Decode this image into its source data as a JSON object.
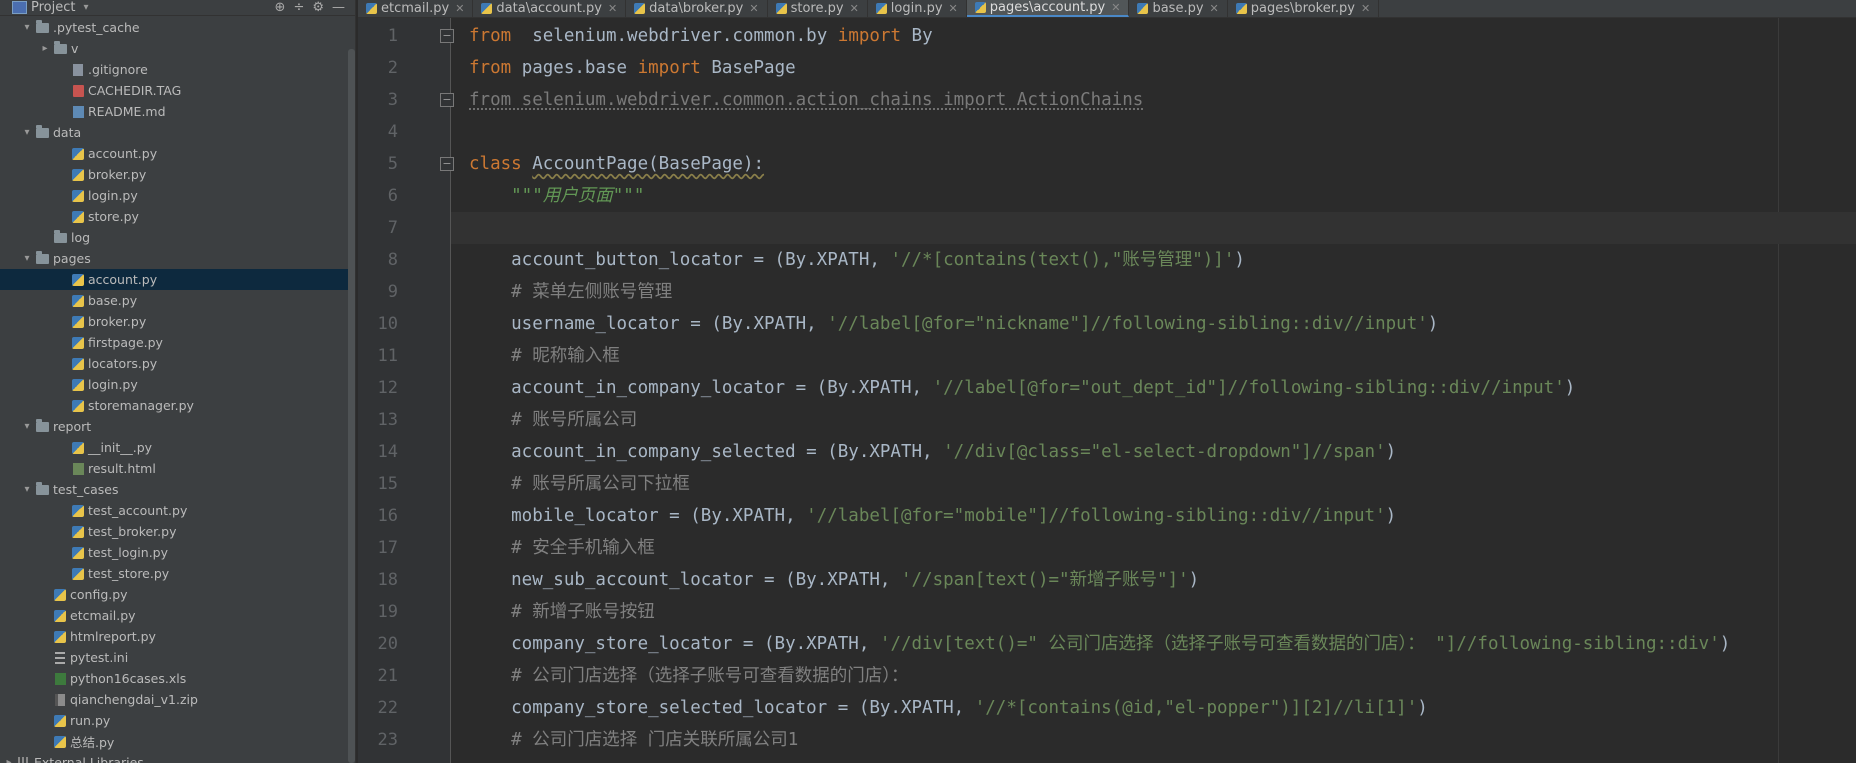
{
  "project_panel": {
    "title": "Project",
    "tools": [
      "⊕",
      "÷",
      "⚙",
      "—"
    ]
  },
  "tree": [
    {
      "depth": 1,
      "arrow": "▾",
      "icon": "folder",
      "label": ".pytest_cache"
    },
    {
      "depth": 2,
      "arrow": "▸",
      "icon": "folder",
      "label": "v"
    },
    {
      "depth": 3,
      "arrow": "",
      "icon": "file",
      "label": ".gitignore"
    },
    {
      "depth": 3,
      "arrow": "",
      "icon": "tag",
      "label": "CACHEDIR.TAG"
    },
    {
      "depth": 3,
      "arrow": "",
      "icon": "md",
      "label": "README.md"
    },
    {
      "depth": 1,
      "arrow": "▾",
      "icon": "folder",
      "label": "data"
    },
    {
      "depth": 3,
      "arrow": "",
      "icon": "py",
      "label": "account.py"
    },
    {
      "depth": 3,
      "arrow": "",
      "icon": "py",
      "label": "broker.py"
    },
    {
      "depth": 3,
      "arrow": "",
      "icon": "py",
      "label": "login.py"
    },
    {
      "depth": 3,
      "arrow": "",
      "icon": "py",
      "label": "store.py"
    },
    {
      "depth": 2,
      "arrow": "",
      "icon": "folder",
      "label": "log"
    },
    {
      "depth": 1,
      "arrow": "▾",
      "icon": "folder",
      "label": "pages"
    },
    {
      "depth": 3,
      "arrow": "",
      "icon": "py",
      "label": "account.py",
      "selected": true
    },
    {
      "depth": 3,
      "arrow": "",
      "icon": "py",
      "label": "base.py"
    },
    {
      "depth": 3,
      "arrow": "",
      "icon": "py",
      "label": "broker.py"
    },
    {
      "depth": 3,
      "arrow": "",
      "icon": "py",
      "label": "firstpage.py"
    },
    {
      "depth": 3,
      "arrow": "",
      "icon": "py",
      "label": "locators.py"
    },
    {
      "depth": 3,
      "arrow": "",
      "icon": "py",
      "label": "login.py"
    },
    {
      "depth": 3,
      "arrow": "",
      "icon": "py",
      "label": "storemanager.py"
    },
    {
      "depth": 1,
      "arrow": "▾",
      "icon": "folder",
      "label": "report"
    },
    {
      "depth": 3,
      "arrow": "",
      "icon": "py",
      "label": "__init__.py"
    },
    {
      "depth": 3,
      "arrow": "",
      "icon": "html",
      "label": "result.html"
    },
    {
      "depth": 1,
      "arrow": "▾",
      "icon": "folder",
      "label": "test_cases"
    },
    {
      "depth": 3,
      "arrow": "",
      "icon": "py",
      "label": "test_account.py"
    },
    {
      "depth": 3,
      "arrow": "",
      "icon": "py",
      "label": "test_broker.py"
    },
    {
      "depth": 3,
      "arrow": "",
      "icon": "py",
      "label": "test_login.py"
    },
    {
      "depth": 3,
      "arrow": "",
      "icon": "py",
      "label": "test_store.py"
    },
    {
      "depth": 2,
      "arrow": "",
      "icon": "py",
      "label": "config.py"
    },
    {
      "depth": 2,
      "arrow": "",
      "icon": "py",
      "label": "etcmail.py"
    },
    {
      "depth": 2,
      "arrow": "",
      "icon": "py",
      "label": "htmlreport.py"
    },
    {
      "depth": 2,
      "arrow": "",
      "icon": "ini",
      "label": "pytest.ini"
    },
    {
      "depth": 2,
      "arrow": "",
      "icon": "xls",
      "label": "python16cases.xls"
    },
    {
      "depth": 2,
      "arrow": "",
      "icon": "zip",
      "label": "qianchengdai_v1.zip"
    },
    {
      "depth": 2,
      "arrow": "",
      "icon": "py",
      "label": "run.py"
    },
    {
      "depth": 2,
      "arrow": "",
      "icon": "py",
      "label": "总结.py"
    },
    {
      "depth": 0,
      "arrow": "▸",
      "icon": "lib",
      "label": "External Libraries"
    }
  ],
  "tabs": [
    {
      "label": "etcmail.py",
      "active": false
    },
    {
      "label": "data\\account.py",
      "active": false
    },
    {
      "label": "data\\broker.py",
      "active": false
    },
    {
      "label": "store.py",
      "active": false
    },
    {
      "label": "login.py",
      "active": false
    },
    {
      "label": "pages\\account.py",
      "active": true
    },
    {
      "label": "base.py",
      "active": false
    },
    {
      "label": "pages\\broker.py",
      "active": false
    }
  ],
  "line_numbers": [
    "1",
    "2",
    "3",
    "4",
    "5",
    "6",
    "7",
    "8",
    "9",
    "10",
    "11",
    "12",
    "13",
    "14",
    "15",
    "16",
    "17",
    "18",
    "19",
    "20",
    "21",
    "22",
    "23"
  ],
  "code_lines": [
    [
      [
        "kw",
        "from"
      ],
      [
        "",
        "  selenium.webdriver.common.by "
      ],
      [
        "kw",
        "import"
      ],
      [
        "",
        " By"
      ]
    ],
    [
      [
        "kw",
        "from"
      ],
      [
        "",
        " pages.base "
      ],
      [
        "kw",
        "import"
      ],
      [
        "",
        " BasePage"
      ]
    ],
    [
      [
        "dim",
        "from selenium.webdriver.common.action_chains import ActionChains"
      ]
    ],
    [],
    [
      [
        "kw",
        "class"
      ],
      [
        "",
        " "
      ],
      [
        "warn",
        "AccountPage(BasePage):"
      ]
    ],
    [
      [
        "doc",
        "    \"\"\"用户页面\"\"\""
      ]
    ],
    [],
    [
      [
        "",
        "    account_button_locator = (By.XPATH, "
      ],
      [
        "str",
        "'//*[contains(text(),\"账号管理\")]'"
      ],
      [
        "",
        ")"
      ]
    ],
    [
      [
        "cmt",
        "    # 菜单左侧账号管理"
      ]
    ],
    [
      [
        "",
        "    username_locator = (By.XPATH, "
      ],
      [
        "str",
        "'//label[@for=\"nickname\"]//following-sibling::div//input'"
      ],
      [
        "",
        ")"
      ]
    ],
    [
      [
        "cmt",
        "    # 昵称输入框"
      ]
    ],
    [
      [
        "",
        "    account_in_company_locator = (By.XPATH, "
      ],
      [
        "str",
        "'//label[@for=\"out_dept_id\"]//following-sibling::div//input'"
      ],
      [
        "",
        ")"
      ]
    ],
    [
      [
        "cmt",
        "    # 账号所属公司"
      ]
    ],
    [
      [
        "",
        "    account_in_company_selected = (By.XPATH, "
      ],
      [
        "str",
        "'//div[@class=\"el-select-dropdown\"]//span'"
      ],
      [
        "",
        ")"
      ]
    ],
    [
      [
        "cmt",
        "    # 账号所属公司下拉框"
      ]
    ],
    [
      [
        "",
        "    mobile_locator = (By.XPATH, "
      ],
      [
        "str",
        "'//label[@for=\"mobile\"]//following-sibling::div//input'"
      ],
      [
        "",
        ")"
      ]
    ],
    [
      [
        "cmt",
        "    # 安全手机输入框"
      ]
    ],
    [
      [
        "",
        "    new_sub_account_locator = (By.XPATH, "
      ],
      [
        "str",
        "'//span[text()=\"新增子账号\"]'"
      ],
      [
        "",
        ")"
      ]
    ],
    [
      [
        "cmt",
        "    # 新增子账号按钮"
      ]
    ],
    [
      [
        "",
        "    company_store_locator = (By.XPATH, "
      ],
      [
        "str",
        "'//div[text()=\" 公司门店选择（选择子账号可查看数据的门店）： \"]//following-sibling::div'"
      ],
      [
        "",
        ")"
      ]
    ],
    [
      [
        "cmt",
        "    # 公司门店选择（选择子账号可查看数据的门店）："
      ]
    ],
    [
      [
        "",
        "    company_store_selected_locator = (By.XPATH, "
      ],
      [
        "str",
        "'//*[contains(@id,\"el-popper\")][2]//li[1]'"
      ],
      [
        "",
        ")"
      ]
    ],
    [
      [
        "cmt",
        "    # 公司门店选择 门店关联所属公司1"
      ]
    ]
  ],
  "current_line": 7,
  "fold_markers": [
    {
      "line": 1,
      "glyph": "−"
    },
    {
      "line": 3,
      "glyph": "−"
    },
    {
      "line": 5,
      "glyph": "−"
    }
  ]
}
